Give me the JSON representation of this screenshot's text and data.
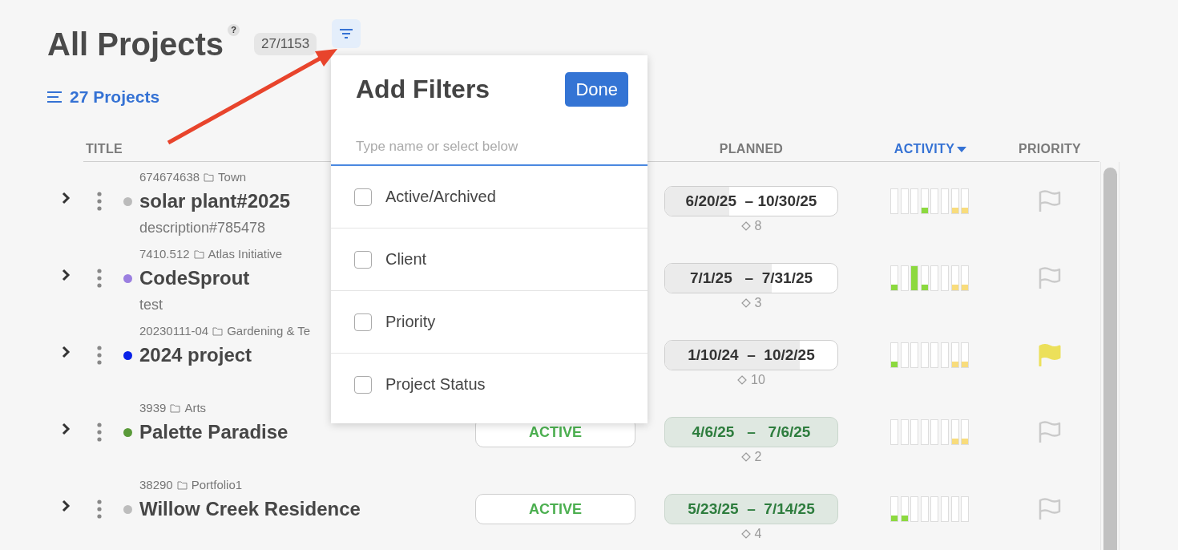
{
  "page": {
    "title": "All Projects",
    "help": "?",
    "count_badge": "27/1153",
    "projects_link": "27 Projects"
  },
  "columns": [
    {
      "label": "TITLE",
      "sorted": false
    },
    {
      "label": "PLANNED",
      "sorted": false
    },
    {
      "label": "ACTIVITY",
      "sorted": true
    },
    {
      "label": "PRIORITY",
      "sorted": false
    }
  ],
  "rows": [
    {
      "number": "674674638",
      "folder": "Town",
      "title": "solar plant#2025",
      "description": "description#785478",
      "color": "#bbbbbb",
      "planned": {
        "kind": "progress",
        "level": 0.37,
        "dates": "6/20/25  – 10/30/25",
        "milestones": "8"
      },
      "activity": [
        {
          "kind": "empty"
        },
        {
          "kind": "empty"
        },
        {
          "kind": "empty"
        },
        {
          "kind": "filled",
          "level": 0.25,
          "color": "#8cd93f"
        },
        {
          "kind": "empty"
        },
        {
          "kind": "empty"
        },
        {
          "kind": "filled",
          "level": 0.25,
          "color": "#f8dc7c"
        },
        {
          "kind": "filled",
          "level": 0.25,
          "color": "#f8dc7c"
        }
      ],
      "flagged": false
    },
    {
      "number": "7410.512",
      "folder": "Atlas Initiative",
      "title": "CodeSprout",
      "description": "test",
      "color": "#9b7fe0",
      "planned": {
        "kind": "progress",
        "level": 0.62,
        "dates": "7/1/25   –  7/31/25",
        "milestones": "3"
      },
      "activity": [
        {
          "kind": "filled",
          "level": 0.25,
          "color": "#8cd93f"
        },
        {
          "kind": "empty"
        },
        {
          "kind": "filled",
          "level": 1,
          "color": "#8cd93f"
        },
        {
          "kind": "filled",
          "level": 0.25,
          "color": "#8cd93f"
        },
        {
          "kind": "empty"
        },
        {
          "kind": "empty"
        },
        {
          "kind": "filled",
          "level": 0.25,
          "color": "#f8dc7c"
        },
        {
          "kind": "filled",
          "level": 0.25,
          "color": "#f8dc7c"
        }
      ],
      "flagged": false
    },
    {
      "number": "20230111-04",
      "folder": "Gardening & Te",
      "title": "2024 project",
      "color": "#0a22e8",
      "planned": {
        "kind": "progress",
        "level": 0.78,
        "dates": "1/10/24  –  10/2/25",
        "milestones": "10"
      },
      "activity": [
        {
          "kind": "filled",
          "level": 0.25,
          "color": "#8cd93f"
        },
        {
          "kind": "empty"
        },
        {
          "kind": "empty"
        },
        {
          "kind": "empty"
        },
        {
          "kind": "empty"
        },
        {
          "kind": "empty"
        },
        {
          "kind": "filled",
          "level": 0.25,
          "color": "#f8dc7c"
        },
        {
          "kind": "filled",
          "level": 0.25,
          "color": "#f8dc7c"
        }
      ],
      "flagged": true
    },
    {
      "number": "3939",
      "folder": "Arts",
      "title": "Palette Paradise",
      "color": "#5a9a3a",
      "status": "ACTIVE",
      "planned": {
        "kind": "on_track",
        "dates": "4/6/25   –   7/6/25",
        "milestones": "2"
      },
      "activity": [
        {
          "kind": "empty"
        },
        {
          "kind": "empty"
        },
        {
          "kind": "empty"
        },
        {
          "kind": "empty"
        },
        {
          "kind": "empty"
        },
        {
          "kind": "empty"
        },
        {
          "kind": "filled",
          "level": 0.25,
          "color": "#f8dc7c"
        },
        {
          "kind": "filled",
          "level": 0.25,
          "color": "#f8dc7c"
        }
      ],
      "flagged": false
    },
    {
      "number": "38290",
      "folder": "Portfolio1",
      "title": "Willow Creek Residence",
      "color": "#bdbdbd",
      "status": "ACTIVE",
      "planned": {
        "kind": "on_track",
        "dates": "5/23/25  –  7/14/25",
        "milestones": "4"
      },
      "activity": [
        {
          "kind": "filled",
          "level": 0.25,
          "color": "#8cd93f"
        },
        {
          "kind": "filled",
          "level": 0.25,
          "color": "#8cd93f"
        },
        {
          "kind": "empty"
        },
        {
          "kind": "empty"
        },
        {
          "kind": "empty"
        },
        {
          "kind": "empty"
        },
        {
          "kind": "empty"
        },
        {
          "kind": "empty"
        }
      ],
      "flagged": false
    }
  ],
  "filter_popover": {
    "title": "Add Filters",
    "done": "Done",
    "placeholder": "Type name or select below",
    "options": [
      {
        "label": "Active/Archived",
        "checked": false
      },
      {
        "label": "Client",
        "checked": false
      },
      {
        "label": "Priority",
        "checked": false
      },
      {
        "label": "Project Status",
        "checked": false
      }
    ]
  }
}
